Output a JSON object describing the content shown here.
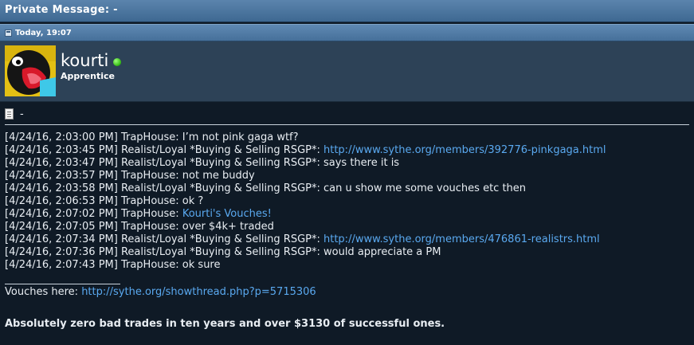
{
  "header": {
    "title": "Private Message: -"
  },
  "date_bar": {
    "icon": "post-icon",
    "label": "Today, 19:07"
  },
  "user": {
    "username": "kourti",
    "rank": "Apprentice",
    "status_color": "#2fb80f"
  },
  "message": {
    "title": "-",
    "lines": [
      {
        "prefix": "[4/24/16, 2:03:00 PM] TrapHouse: I’m not pink gaga wtf?",
        "link": ""
      },
      {
        "prefix": "[4/24/16, 2:03:45 PM] Realist/Loyal *Buying & Selling RSGP*: ",
        "link": "http://www.sythe.org/members/392776-pinkgaga.html"
      },
      {
        "prefix": "[4/24/16, 2:03:47 PM] Realist/Loyal *Buying & Selling RSGP*: says there it is",
        "link": ""
      },
      {
        "prefix": "[4/24/16, 2:03:57 PM] TrapHouse: not me buddy",
        "link": ""
      },
      {
        "prefix": "[4/24/16, 2:03:58 PM] Realist/Loyal *Buying & Selling RSGP*: can u show me some vouches etc then",
        "link": ""
      },
      {
        "prefix": "[4/24/16, 2:06:53 PM] TrapHouse: ok ?",
        "link": ""
      },
      {
        "prefix": "[4/24/16, 2:07:02 PM] TrapHouse: ",
        "link": "Kourti's Vouches!"
      },
      {
        "prefix": "[4/24/16, 2:07:05 PM] TrapHouse: over $4k+ traded",
        "link": ""
      },
      {
        "prefix": "[4/24/16, 2:07:34 PM] Realist/Loyal *Buying & Selling RSGP*: ",
        "link": "http://www.sythe.org/members/476861-realistrs.html"
      },
      {
        "prefix": "[4/24/16, 2:07:36 PM] Realist/Loyal *Buying & Selling RSGP*: would appreciate a PM",
        "link": ""
      },
      {
        "prefix": "[4/24/16, 2:07:43 PM] TrapHouse: ok sure",
        "link": ""
      }
    ]
  },
  "signature": {
    "vouches_label": "Vouches here: ",
    "vouches_link": "http://sythe.org/showthread.php?p=5715306",
    "bold_text": "Absolutely zero bad trades in ten years and over $3130 of successful ones."
  },
  "colors": {
    "link": "#5aa9f0",
    "background": "#0f1a26",
    "header": "#4a74a0"
  }
}
